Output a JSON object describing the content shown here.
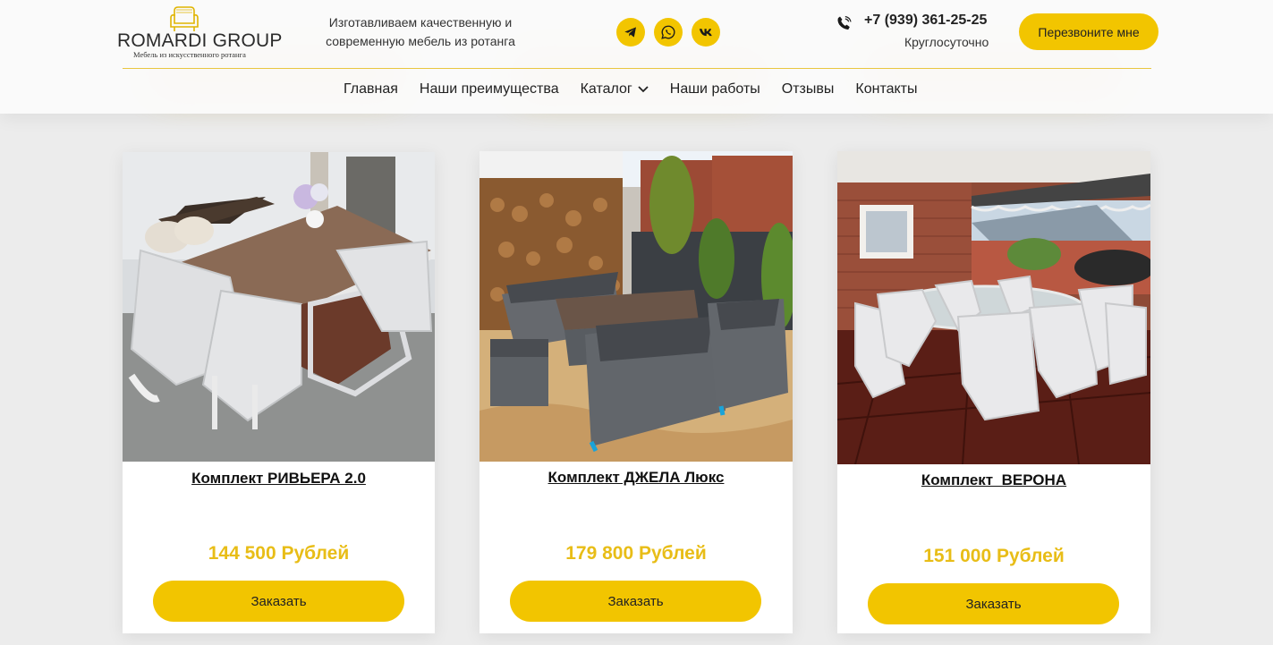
{
  "brand": {
    "name": "ROMARDI GROUP",
    "subtitle": "Мебель из искусственного ротанга",
    "tagline_line1": "Изготавливаем качественную и",
    "tagline_line2": "современную мебель из ротанга"
  },
  "socials": [
    {
      "icon": "telegram-icon"
    },
    {
      "icon": "whatsapp-icon"
    },
    {
      "icon": "vk-icon"
    }
  ],
  "contact": {
    "phone": "+7 (939) 361-25-25",
    "hours": "Круглосуточно",
    "callback_label": "Перезвоните мне"
  },
  "nav": {
    "items": [
      "Главная",
      "Наши преимущества",
      "Каталог",
      "Наши работы",
      "Отзывы",
      "Контакты"
    ]
  },
  "products": [
    {
      "title": "Комплект РИВЬЕРА 2.0",
      "price": "144 500 Рублей",
      "button": "Заказать"
    },
    {
      "title": "Комплект ДЖЕЛА Люкс",
      "price": "179 800 Рублей",
      "button": "Заказать"
    },
    {
      "title": "Комплект  ВЕРОНА",
      "price": "151 000 Рублей",
      "button": "Заказать"
    }
  ],
  "colors": {
    "accent": "#f2c500",
    "price": "#e8bd17",
    "header_bg": "#fafafa",
    "page_bg": "#ececec"
  }
}
